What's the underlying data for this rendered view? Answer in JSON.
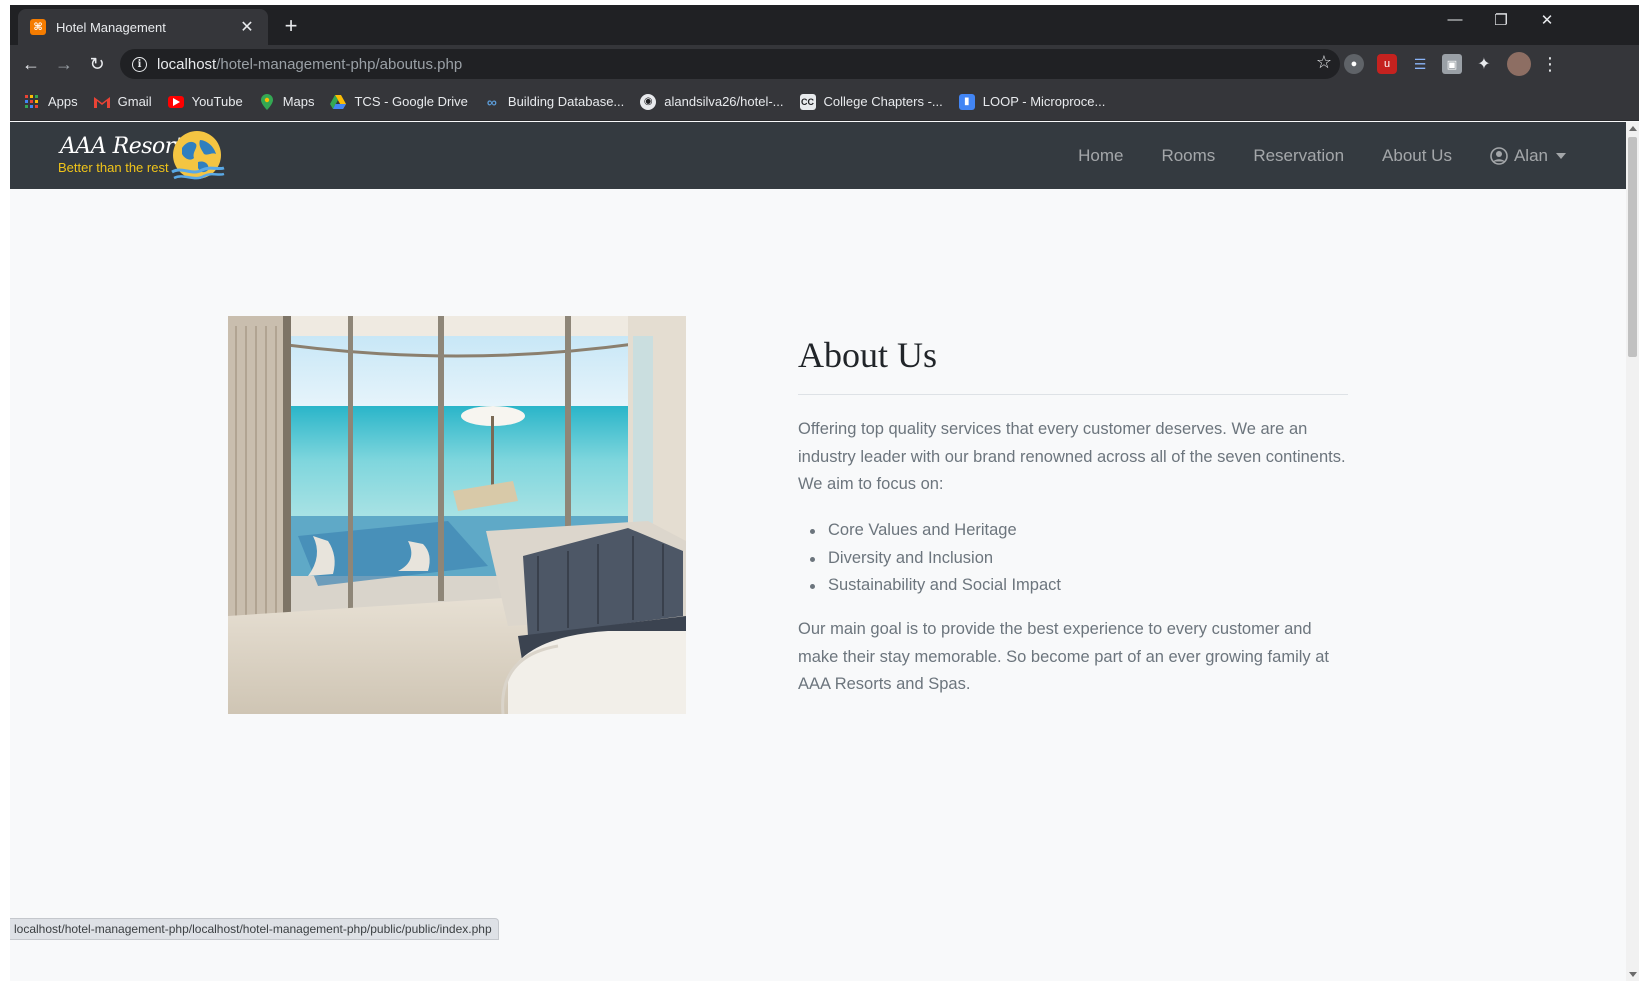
{
  "browser": {
    "tab_title": "Hotel Management",
    "url_host": "localhost",
    "url_path": "/hotel-management-php/aboutus.php",
    "bookmarks": [
      {
        "label": "Apps",
        "icon": "apps-grid-icon"
      },
      {
        "label": "Gmail",
        "icon": "gmail-icon"
      },
      {
        "label": "YouTube",
        "icon": "youtube-icon"
      },
      {
        "label": "Maps",
        "icon": "maps-icon"
      },
      {
        "label": "TCS - Google Drive",
        "icon": "google-drive-icon"
      },
      {
        "label": "Building Database...",
        "icon": "codeanywhere-icon"
      },
      {
        "label": "alandsilva26/hotel-...",
        "icon": "github-icon"
      },
      {
        "label": "College Chapters -...",
        "icon": "cc-icon"
      },
      {
        "label": "LOOP - Microproce...",
        "icon": "loop-icon"
      }
    ],
    "status_url": "localhost/hotel-management-php/localhost/hotel-management-php/public/public/index.php"
  },
  "site": {
    "brand_name": "AAA Resorts",
    "brand_tagline": "Better than the rest",
    "nav": {
      "home": "Home",
      "rooms": "Rooms",
      "reservation": "Reservation",
      "about": "About Us",
      "user": "Alan"
    }
  },
  "about": {
    "title": "About Us",
    "intro": "Offering top quality services that every customer deserves. We are an industry leader with our brand renowned across all of the seven continents. We aim to focus on:",
    "focus": [
      "Core Values and Heritage",
      "Diversity and Inclusion",
      "Sustainability and Social Impact"
    ],
    "closing": "Our main goal is to provide the best experience to every customer and make their stay memorable. So become part of an ever growing family at AAA Resorts and Spas."
  },
  "colors": {
    "navbar_bg": "#343a40",
    "page_bg": "#f8f9fa",
    "tagline": "#f0c419",
    "text_muted": "#6c757d"
  }
}
